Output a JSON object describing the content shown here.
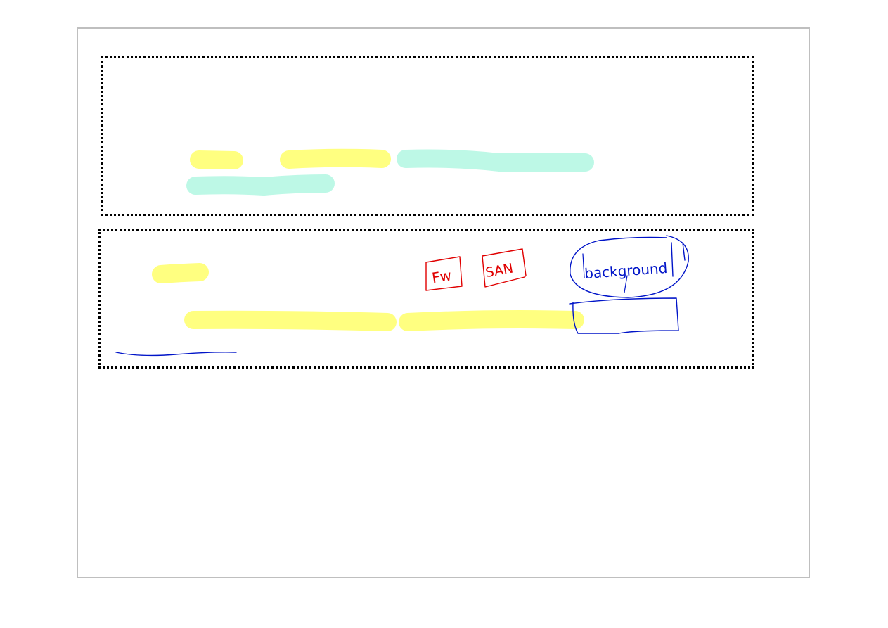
{
  "annotations": {
    "tag_fw": "Fw",
    "tag_san": "SAN",
    "tag_background": "background"
  },
  "colors": {
    "highlight_yellow": "#ffff80",
    "highlight_mint": "#bdf8e6",
    "ink_red": "#e00000",
    "ink_blue": "#0014c8",
    "frame_border": "#bfbfbf",
    "box_border": "#000000"
  }
}
